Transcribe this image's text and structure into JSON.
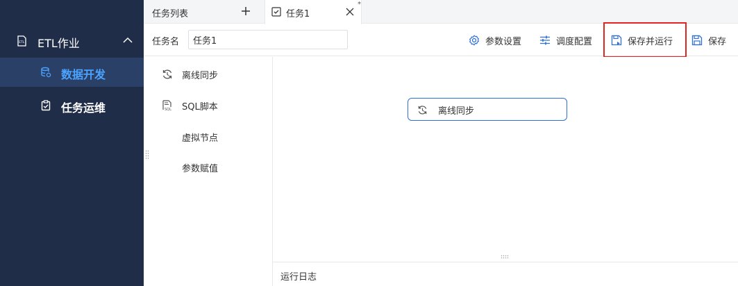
{
  "sidebar": {
    "group": {
      "label": "ETL作业",
      "icon": "etl-icon",
      "expanded": true
    },
    "items": [
      {
        "label": "数据开发",
        "icon": "database-icon",
        "active": true
      },
      {
        "label": "任务运维",
        "icon": "clipboard-check-icon",
        "active": false
      }
    ]
  },
  "tabs": {
    "list_tab": {
      "label": "任务列表",
      "add_icon": "plus-icon"
    },
    "active_tab": {
      "label": "任务1",
      "icon": "task-check-icon",
      "close_icon": "close-icon",
      "modified_mark": "*"
    }
  },
  "toolbar": {
    "task_name_label": "任务名",
    "task_name_value": "任务1",
    "params_label": "参数设置",
    "schedule_label": "调度配置",
    "save_run_label": "保存并运行",
    "save_label": "保存"
  },
  "palette": {
    "items": [
      {
        "label": "离线同步",
        "icon": "sync-icon"
      },
      {
        "label": "SQL脚本",
        "icon": "sql-script-icon"
      },
      {
        "label": "虚拟节点",
        "icon": ""
      },
      {
        "label": "参数赋值",
        "icon": ""
      }
    ]
  },
  "canvas": {
    "nodes": [
      {
        "label": "离线同步",
        "icon": "sync-icon"
      }
    ]
  },
  "log": {
    "label": "运行日志"
  },
  "colors": {
    "sidebar_bg": "#1f2d48",
    "sidebar_active_bg": "#2b4066",
    "sidebar_active_text": "#4aa3ff",
    "node_border": "#2f6fd9",
    "highlight": "#e3231f"
  }
}
